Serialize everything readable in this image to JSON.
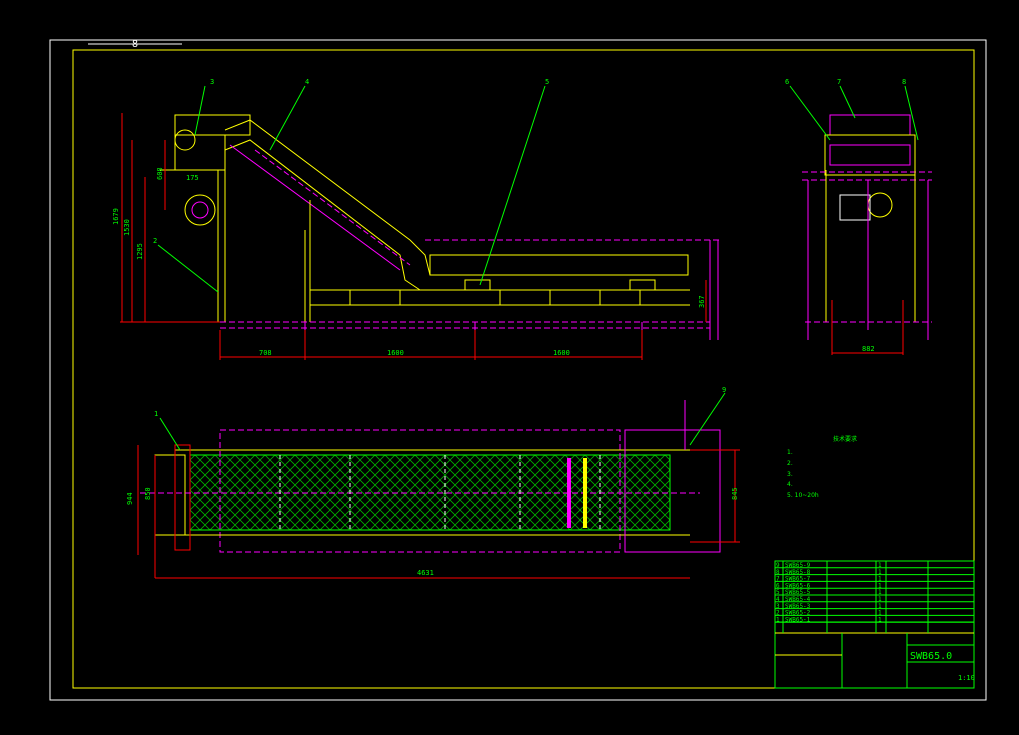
{
  "drawing": {
    "title_number": "8",
    "balloons": [
      "1",
      "2",
      "3",
      "4",
      "5",
      "6",
      "7",
      "8",
      "9"
    ],
    "dimensions": {
      "front_bottom": [
        "708",
        "1600",
        "1600"
      ],
      "front_heights": [
        "1679",
        "1530",
        "1295",
        "608"
      ],
      "front_small": "175",
      "front_right": "367",
      "side_width": "882",
      "plan_length": "4631",
      "plan_left": [
        "944",
        "850"
      ],
      "plan_right": "845"
    },
    "notes": {
      "heading": "技术要求",
      "items": [
        "1.",
        "2.",
        "3.",
        "4.",
        "5. 10~20h"
      ]
    },
    "parts_list": [
      {
        "no": "9",
        "code": "SWB65-9",
        "qty": "1"
      },
      {
        "no": "8",
        "code": "SWB65-8",
        "qty": "1"
      },
      {
        "no": "7",
        "code": "SWB65-7",
        "qty": "1"
      },
      {
        "no": "6",
        "code": "SWB65-6",
        "qty": "1"
      },
      {
        "no": "5",
        "code": "SWB65-5",
        "qty": "1"
      },
      {
        "no": "4",
        "code": "SWB65-4",
        "qty": "1"
      },
      {
        "no": "3",
        "code": "SWB65-3",
        "qty": "1"
      },
      {
        "no": "2",
        "code": "SWB65-2",
        "qty": "1"
      },
      {
        "no": "1",
        "code": "SWB65-1",
        "qty": "1"
      }
    ],
    "title_block": {
      "drawing_no": "SWB65.0",
      "scale": "1:10"
    },
    "colors": {
      "background": "#000000",
      "frame": "#ffff00",
      "dimension": "#ff0000",
      "text": "#00ff00",
      "centerline": "#ff00ff",
      "outline": "#ffff00"
    }
  }
}
